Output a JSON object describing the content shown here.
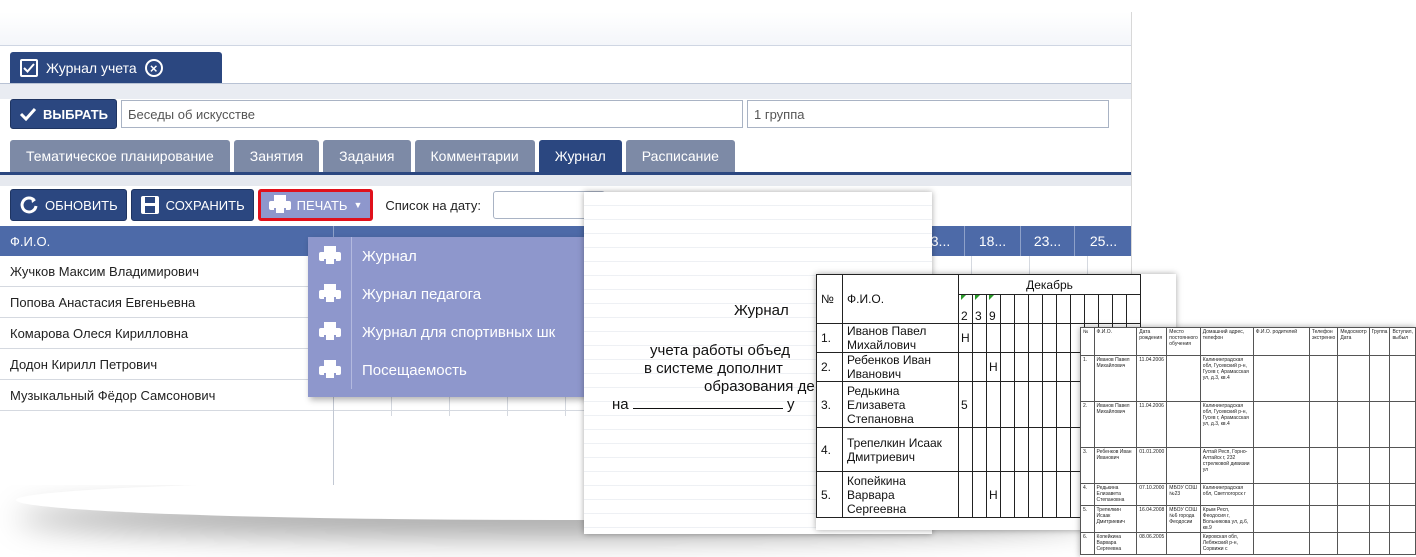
{
  "doc_tab": {
    "title": "Журнал учета"
  },
  "selection": {
    "choose_label": "ВЫБРАТЬ",
    "course_value": "Беседы об искусстве",
    "group_value": "1 группа"
  },
  "tabs": [
    {
      "label": "Тематическое планирование",
      "active": false
    },
    {
      "label": "Занятия",
      "active": false
    },
    {
      "label": "Задания",
      "active": false
    },
    {
      "label": "Комментарии",
      "active": false
    },
    {
      "label": "Журнал",
      "active": true
    },
    {
      "label": "Расписание",
      "active": false
    }
  ],
  "toolbar": {
    "refresh_label": "ОБНОВИТЬ",
    "save_label": "СОХРАНИТЬ",
    "print_label": "ПЕЧАТЬ",
    "date_label": "Список на дату:"
  },
  "grid": {
    "fio_header": "Ф.И.О.",
    "date_columns": [
      "3...",
      "18...",
      "23...",
      "25..."
    ],
    "students": [
      "Жучков Максим Владимирович",
      "Попова Анастасия Евгеньевна",
      "Комарова Олеся Кирилловна",
      "Додон Кирилл Петрович",
      "Музыкальный Фёдор Самсонович"
    ]
  },
  "print_menu": {
    "items": [
      "Журнал",
      "Журнал педагога",
      "Журнал для спортивных шк",
      "Посещаемость"
    ]
  },
  "preview_title_page": {
    "title": "Журнал",
    "line1": "учета работы объед",
    "line2": "в системе дополнит",
    "line3": "образования де",
    "line4_prefix": "на",
    "line4_suffix": "у"
  },
  "preview_journal": {
    "num_header": "№",
    "fio_header": "Ф.И.О.",
    "month": "Декабрь",
    "days": [
      "2",
      "3",
      "9"
    ],
    "rows": [
      {
        "num": "1.",
        "name": "Иванов Павел Михайлович",
        "marks": [
          "Н",
          "",
          ""
        ]
      },
      {
        "num": "2.",
        "name": "Ребенков Иван Иванович",
        "marks": [
          "",
          "",
          "Н"
        ]
      },
      {
        "num": "3.",
        "name": "Редькина Елизавета Степановна",
        "marks": [
          "5",
          "",
          ""
        ]
      },
      {
        "num": "4.",
        "name": "Трепелкин Исаак Дмитриевич",
        "marks": [
          "",
          "",
          ""
        ]
      },
      {
        "num": "5.",
        "name": "Копейкина Варвара Сергеевна",
        "marks": [
          "",
          "",
          "Н"
        ]
      }
    ]
  },
  "preview_list": {
    "headers": [
      "№",
      "Ф.И.О.",
      "Дата рождения",
      "Место постоянного обучения",
      "Домашний адрес, телефон",
      "Ф.И.О. родителей",
      "Телефон экстренно",
      "Медосмотр Дата",
      "Группа",
      "Вступил, выбыл"
    ],
    "rows": [
      {
        "num": "1.",
        "name": "Иванов Павел Михайлович",
        "birth": "11.04.2006",
        "school": "",
        "address": "Калининградская обл, Гусевский р-н, Гусев г, Арамасская ул, д.3, кв.4"
      },
      {
        "num": "2.",
        "name": "Иванов Павел Михайлович",
        "birth": "11.04.2006",
        "school": "",
        "address": "Калининградская обл, Гусевский р-н, Гусев г, Арамасская ул, д.3, кв.4"
      },
      {
        "num": "3.",
        "name": "Ребенков Иван Иванович",
        "birth": "01.01.2000",
        "school": "",
        "address": "Алтай Респ, Горно-Алтайск г, 232 стрелковой дивизии ул"
      },
      {
        "num": "4.",
        "name": "Редькина Елизавета Степановна",
        "birth": "07.10.2000",
        "school": "МБОУ СОШ №23",
        "address": "Калининградская обл, Светлогорск г"
      },
      {
        "num": "5.",
        "name": "Трепелкин Исаак Дмитриевич",
        "birth": "16.04.2008",
        "school": "МБОУ СОШ №6 города Феодосии",
        "address": "Крым Респ, Феодосия г, Вольникова ул, д.6, кв.9"
      },
      {
        "num": "6.",
        "name": "Копейкина Варвара Сергеевна",
        "birth": "08.06.2005",
        "school": "",
        "address": "Кировская обл, Лебяжский р-н, Сорвижи с"
      }
    ]
  },
  "colors": {
    "primary": "#2b4780",
    "tab_inactive": "#7d8aa6",
    "grid_header": "#4d6aa8",
    "menu": "#8e97cc",
    "highlight_border": "#e0101b"
  }
}
